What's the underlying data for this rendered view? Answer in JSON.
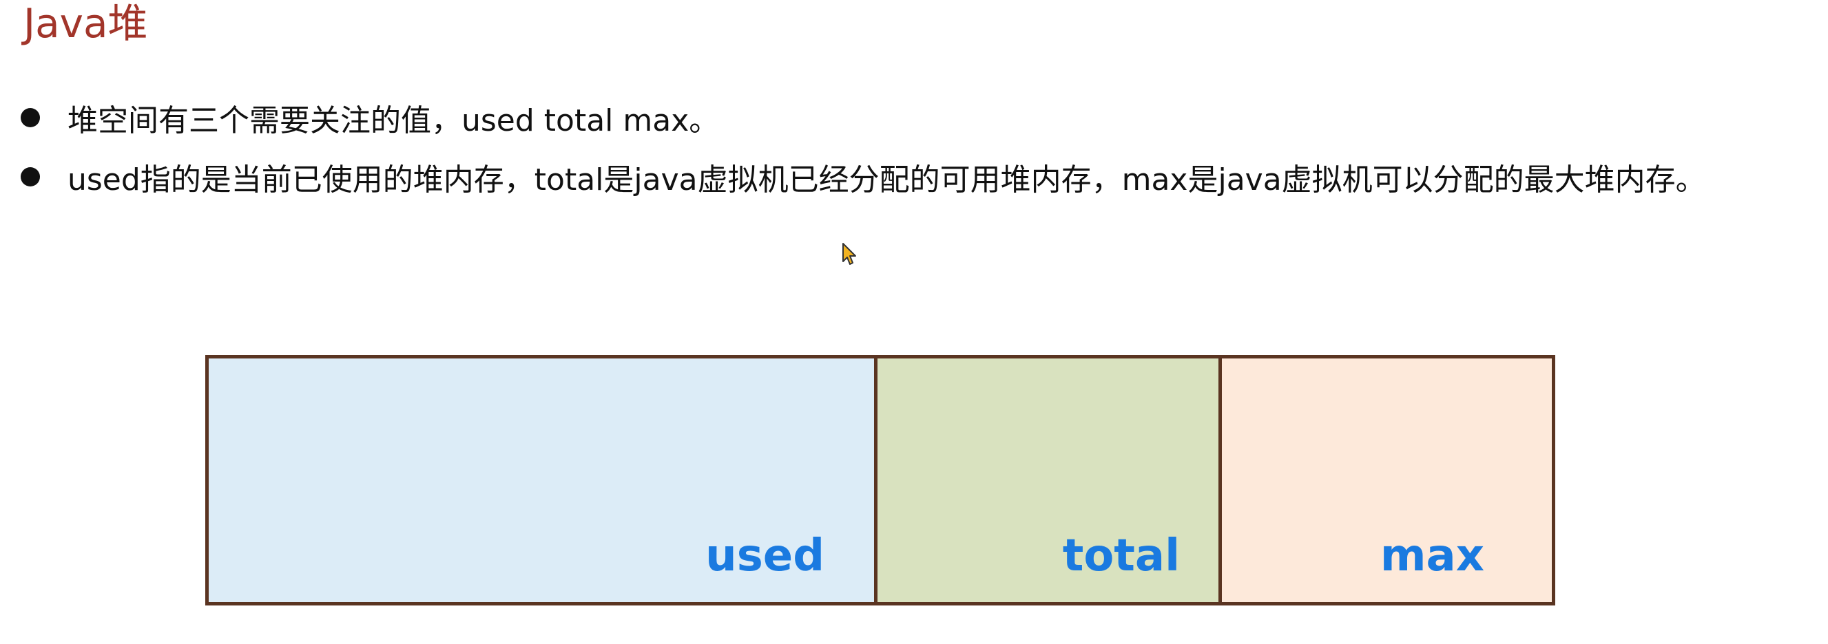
{
  "title": "Java堆",
  "bullets": [
    "堆空间有三个需要关注的值，used total max。",
    "used指的是当前已使用的堆内存，total是java虚拟机已经分配的可用堆内存，max是java虚拟机可以分配的最大堆内存。"
  ],
  "diagram": {
    "segments": [
      {
        "label": "used",
        "color": "#dcecf7"
      },
      {
        "label": "total",
        "color": "#d9e2bf"
      },
      {
        "label": "max",
        "color": "#fde9da"
      }
    ],
    "border_color": "#5a3421",
    "label_color": "#1a7ae0"
  },
  "colors": {
    "title": "#a2352a",
    "text": "#111111"
  },
  "icons": {
    "cursor": "mouse-pointer-icon"
  }
}
